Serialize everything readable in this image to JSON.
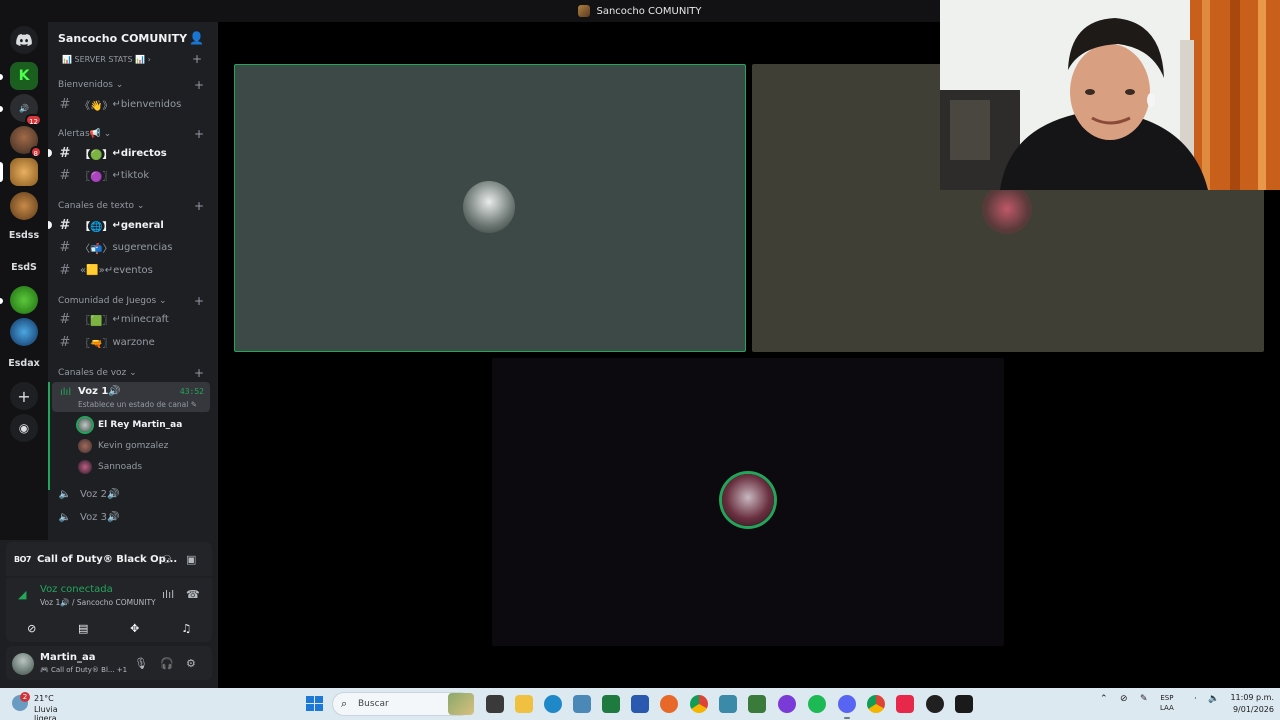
{
  "window": {
    "title": "Sancocho COMUNITY"
  },
  "rail": {
    "badges": [
      "12",
      "8"
    ],
    "text_servers": [
      "Esdss",
      "EsdS",
      "Esdax"
    ]
  },
  "server": {
    "name": "Sancocho COMUNITY",
    "stats_label": "📊 SERVER STATS 📊 ›"
  },
  "categories": [
    {
      "name": "Bienvenidos",
      "channels": [
        {
          "deco": "《👋》",
          "label": "↵bienvenidos"
        }
      ]
    },
    {
      "name": "Alertas📢",
      "channels": [
        {
          "deco": "【🟢】",
          "label": "↵directos"
        },
        {
          "deco": "〖🟣〗",
          "label": "↵tiktok"
        }
      ]
    },
    {
      "name": "Canales de texto",
      "channels": [
        {
          "deco": "【🌐】",
          "label": "↵general"
        },
        {
          "deco": "〈📬〉",
          "label": "sugerencias"
        },
        {
          "deco": "«🟨»",
          "label": "↵eventos"
        }
      ]
    },
    {
      "name": "Comunidad de Juegos",
      "channels": [
        {
          "deco": "〖🟩〗",
          "label": "↵minecraft"
        },
        {
          "deco": "〖🔫〗",
          "label": "warzone"
        }
      ]
    },
    {
      "name": "Canales de voz"
    }
  ],
  "voice": {
    "active": {
      "name": "Voz 1🔊",
      "timer": "43:52",
      "status": "Establece un estado de canal ✎"
    },
    "users": [
      "El Rey Martin_aa",
      "Kevin gomzalez",
      "Sannoads"
    ],
    "others": [
      "Voz 2🔊",
      "Voz 3🔊"
    ]
  },
  "activity": {
    "game_tag": "BO7",
    "title": "Call of Duty® Black Op..."
  },
  "connection": {
    "title": "Voz conectada",
    "sub": "Voz 1🔊 / Sancocho COMUNITY"
  },
  "user": {
    "name": "Martin_aa",
    "status": "🎮 Call of Duty® Bl... +1"
  },
  "taskbar": {
    "weather_badge": "2",
    "temp": "21°C",
    "condition": "Lluvia ligera",
    "search": "Buscar",
    "lang": "ESP",
    "lang2": "LAA",
    "time": "11:09 p.m.",
    "date": "9/01/2026"
  },
  "colors": {
    "accent_green": "#23a55a",
    "rail_bg": "#121214",
    "sidebar_bg": "#1e1f22",
    "taskbar_bg": "#dce9f0"
  }
}
